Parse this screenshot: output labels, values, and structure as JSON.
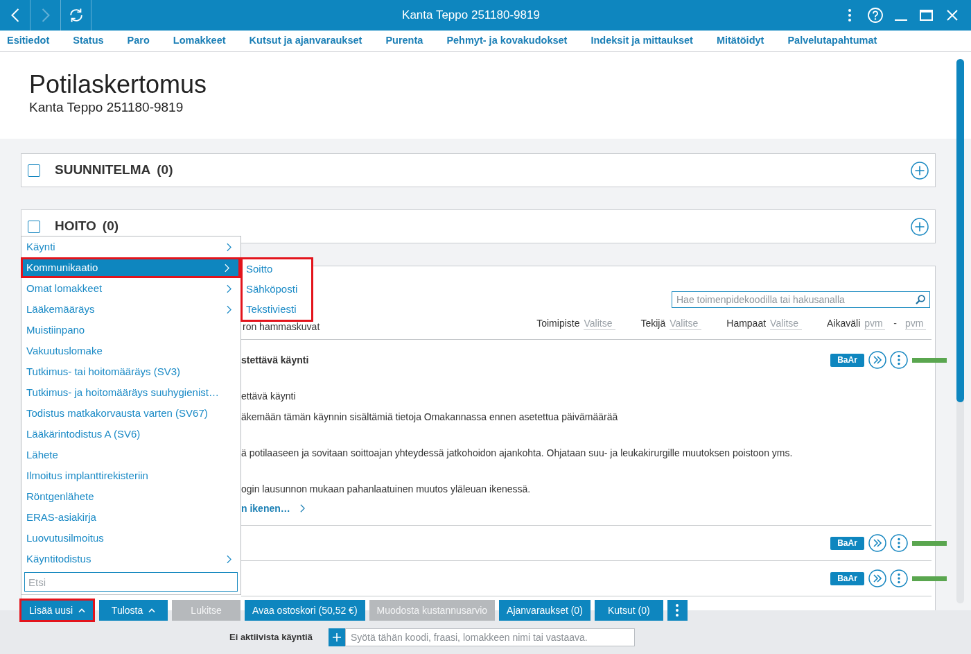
{
  "window": {
    "title": "Kanta Teppo 251180-9819",
    "nav_buttons": [
      {
        "kind": "back",
        "disabled": false
      },
      {
        "kind": "forward",
        "disabled": true
      },
      {
        "kind": "refresh",
        "disabled": false
      }
    ],
    "controls": [
      {
        "kind": "more"
      },
      {
        "kind": "help"
      },
      {
        "kind": "minimize"
      },
      {
        "kind": "maximize"
      },
      {
        "kind": "close"
      }
    ]
  },
  "tabs": [
    "Esitiedot",
    "Status",
    "Paro",
    "Lomakkeet",
    "Kutsut ja ajanvaraukset",
    "Purenta",
    "Pehmyt- ja kovakudokset",
    "Indeksit ja mittaukset",
    "Mitätöidyt",
    "Palvelutapahtumat"
  ],
  "header": {
    "title": "Potilaskertomus",
    "subtitle": "Kanta Teppo 251180-9819"
  },
  "sections": [
    {
      "title": "SUUNNITELMA",
      "count": "(0)",
      "checked": false
    },
    {
      "title": "HOITO",
      "count": "(0)",
      "checked": false
    }
  ],
  "record": {
    "search": {
      "placeholder": "Hae toimenpidekoodilla tai hakusanalla"
    },
    "filter_text": "ron hammaskuvat",
    "filters": [
      {
        "kind": "select",
        "label": "Toimipiste",
        "placeholder": "Valitse"
      },
      {
        "kind": "select",
        "label": "Tekijä",
        "placeholder": "Valitse"
      },
      {
        "kind": "select",
        "label": "Hampaat",
        "placeholder": "Valitse"
      },
      {
        "kind": "range",
        "label": "Aikaväli",
        "placeholder": "pvm",
        "separator": "-",
        "placeholder_end": "pvm"
      }
    ],
    "entries": [
      {
        "title": "stettävä käynti",
        "badge": "BaAr",
        "paragraphs": [
          [
            "ettävä käynti",
            "äkemään tämän käynnin sisältämiä tietoja Omakannassa ennen asetettua päivämäärää"
          ],
          [
            "ä potilaaseen ja sovitaan soittoajan yhteydessä jatkohoidon ajankohta. Ohjataan suu- ja leukakirurgille muutoksen poistoon yms."
          ],
          [
            "ogin lausunnon mukaan pahanlaatuinen muutos yläleuan ikenessä."
          ]
        ],
        "link": "n ikenen…"
      },
      {
        "badge": "BaAr"
      },
      {
        "badge": "BaAr"
      }
    ]
  },
  "menu": {
    "items": [
      {
        "label": "Käynti",
        "submenu": true,
        "selected": false,
        "highlighted": false
      },
      {
        "label": "Kommunikaatio",
        "submenu": true,
        "selected": true,
        "highlighted": true
      },
      {
        "label": "Omat lomakkeet",
        "submenu": true,
        "selected": false,
        "highlighted": false
      },
      {
        "label": "Lääkemääräys",
        "submenu": true,
        "selected": false,
        "highlighted": false
      },
      {
        "label": "Muistiinpano",
        "submenu": false,
        "selected": false,
        "highlighted": false
      },
      {
        "label": "Vakuutuslomake",
        "submenu": false,
        "selected": false,
        "highlighted": false
      },
      {
        "label": "Tutkimus- tai hoitomääräys (SV3)",
        "submenu": false,
        "selected": false,
        "highlighted": false
      },
      {
        "label": "Tutkimus- ja hoitomääräys suuhygienist…",
        "submenu": false,
        "selected": false,
        "highlighted": false
      },
      {
        "label": "Todistus matkakorvausta varten (SV67)",
        "submenu": false,
        "selected": false,
        "highlighted": false
      },
      {
        "label": "Lääkärintodistus A (SV6)",
        "submenu": false,
        "selected": false,
        "highlighted": false
      },
      {
        "label": "Lähete",
        "submenu": false,
        "selected": false,
        "highlighted": false
      },
      {
        "label": "Ilmoitus implanttirekisteriin",
        "submenu": false,
        "selected": false,
        "highlighted": false
      },
      {
        "label": "Röntgenlähete",
        "submenu": false,
        "selected": false,
        "highlighted": false
      },
      {
        "label": "ERAS-asiakirja",
        "submenu": false,
        "selected": false,
        "highlighted": false
      },
      {
        "label": "Luovutusilmoitus",
        "submenu": false,
        "selected": false,
        "highlighted": false
      },
      {
        "label": "Käyntitodistus",
        "submenu": true,
        "selected": false,
        "highlighted": false
      }
    ],
    "submenu": {
      "highlighted": true,
      "items": [
        "Soitto",
        "Sähköposti",
        "Tekstiviesti"
      ]
    },
    "search": {
      "placeholder": "Etsi"
    }
  },
  "toolbar": [
    {
      "kind": "dropdown",
      "label": "Lisää uusi",
      "disabled": false,
      "highlighted": true
    },
    {
      "kind": "dropdown",
      "label": "Tulosta",
      "disabled": false,
      "highlighted": false
    },
    {
      "kind": "plain",
      "label": "Lukitse",
      "disabled": true,
      "highlighted": false
    },
    {
      "kind": "plain",
      "label": "Avaa ostoskori (50,52 €)",
      "disabled": false,
      "highlighted": false
    },
    {
      "kind": "plain",
      "label": "Muodosta kustannusarvio",
      "disabled": true,
      "highlighted": false
    },
    {
      "kind": "plain",
      "label": "Ajanvaraukset (0)",
      "disabled": false,
      "highlighted": false
    },
    {
      "kind": "plain",
      "label": "Kutsut (0)",
      "disabled": false,
      "highlighted": false
    },
    {
      "kind": "more",
      "disabled": false,
      "highlighted": false
    }
  ],
  "footer": {
    "status": "Ei aktiivista käyntiä",
    "input": {
      "placeholder": "Syötä tähän koodi, fraasi, lomakkeen nimi tai vastaava."
    }
  }
}
